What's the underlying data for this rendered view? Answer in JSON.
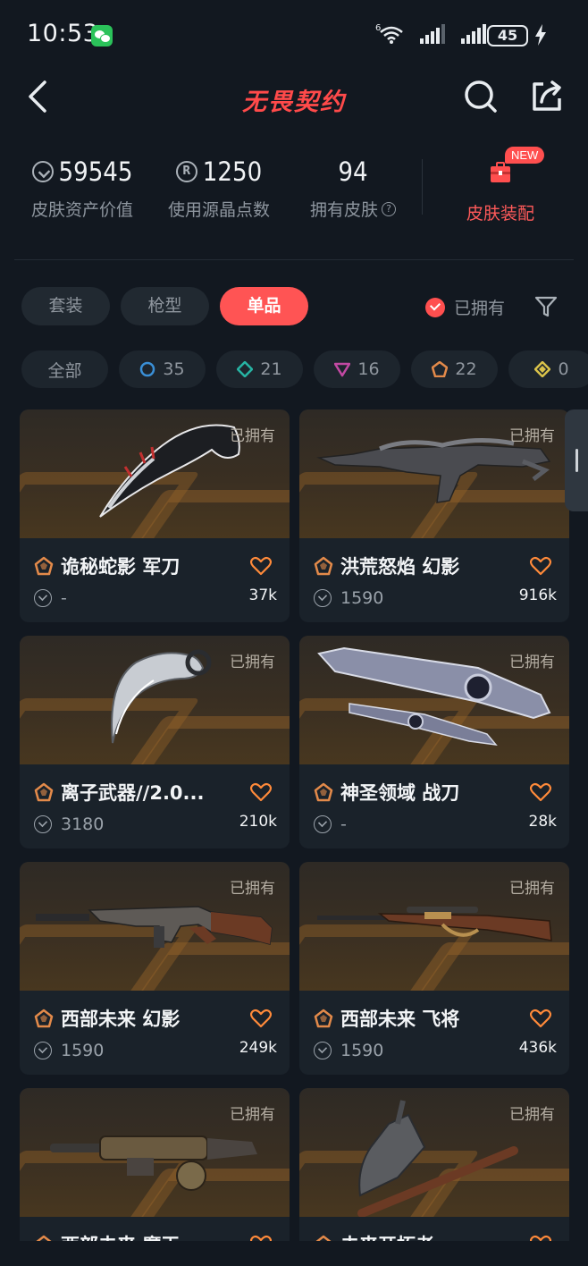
{
  "status_bar": {
    "time": "10:53",
    "battery": "45",
    "network": "6"
  },
  "header": {
    "title": "无畏契约"
  },
  "stats": {
    "asset_value": "59545",
    "asset_label": "皮肤资产价值",
    "points_value": "1250",
    "points_label": "使用源晶点数",
    "skins_value": "94",
    "skins_label": "拥有皮肤",
    "equip_label": "皮肤装配",
    "new_badge": "NEW"
  },
  "tabs": [
    {
      "label": "套装",
      "active": false
    },
    {
      "label": "枪型",
      "active": false
    },
    {
      "label": "单品",
      "active": true
    }
  ],
  "owned_filter": {
    "label": "已拥有",
    "checked": true
  },
  "rarity_chips": [
    {
      "label": "全部",
      "icon": "all",
      "color": ""
    },
    {
      "label": "35",
      "icon": "circle",
      "color": "#3a8fd6"
    },
    {
      "label": "21",
      "icon": "diamond",
      "color": "#27b3a3"
    },
    {
      "label": "16",
      "icon": "triangle",
      "color": "#c249a3"
    },
    {
      "label": "22",
      "icon": "pentagon",
      "color": "#e38a4a"
    },
    {
      "label": "0",
      "icon": "diamond-gold",
      "color": "#d9c24a"
    }
  ],
  "owned_tag": "已拥有",
  "skins": [
    {
      "name": "诡秘蛇影 军刀",
      "price": "-",
      "likes": "37k",
      "weapon": "karambit-dark"
    },
    {
      "name": "洪荒怒焰 幻影",
      "price": "1590",
      "likes": "916k",
      "weapon": "rifle-dragon"
    },
    {
      "name": "离子武器//2.0...",
      "price": "3180",
      "likes": "210k",
      "weapon": "karambit-silver"
    },
    {
      "name": "神圣领域 战刀",
      "price": "-",
      "likes": "28k",
      "weapon": "blade-sacred"
    },
    {
      "name": "西部未来 幻影",
      "price": "1590",
      "likes": "249k",
      "weapon": "rifle-wood"
    },
    {
      "name": "西部未来 飞将",
      "price": "1590",
      "likes": "436k",
      "weapon": "sniper-wood"
    },
    {
      "name": "西部未来 魔王",
      "price": "",
      "likes": "",
      "weapon": "minigun"
    },
    {
      "name": "未来开拓者",
      "price": "",
      "likes": "",
      "weapon": "axe"
    }
  ],
  "colors": {
    "accent": "#ff5454",
    "background": "#121820",
    "card": "#1a222a"
  }
}
